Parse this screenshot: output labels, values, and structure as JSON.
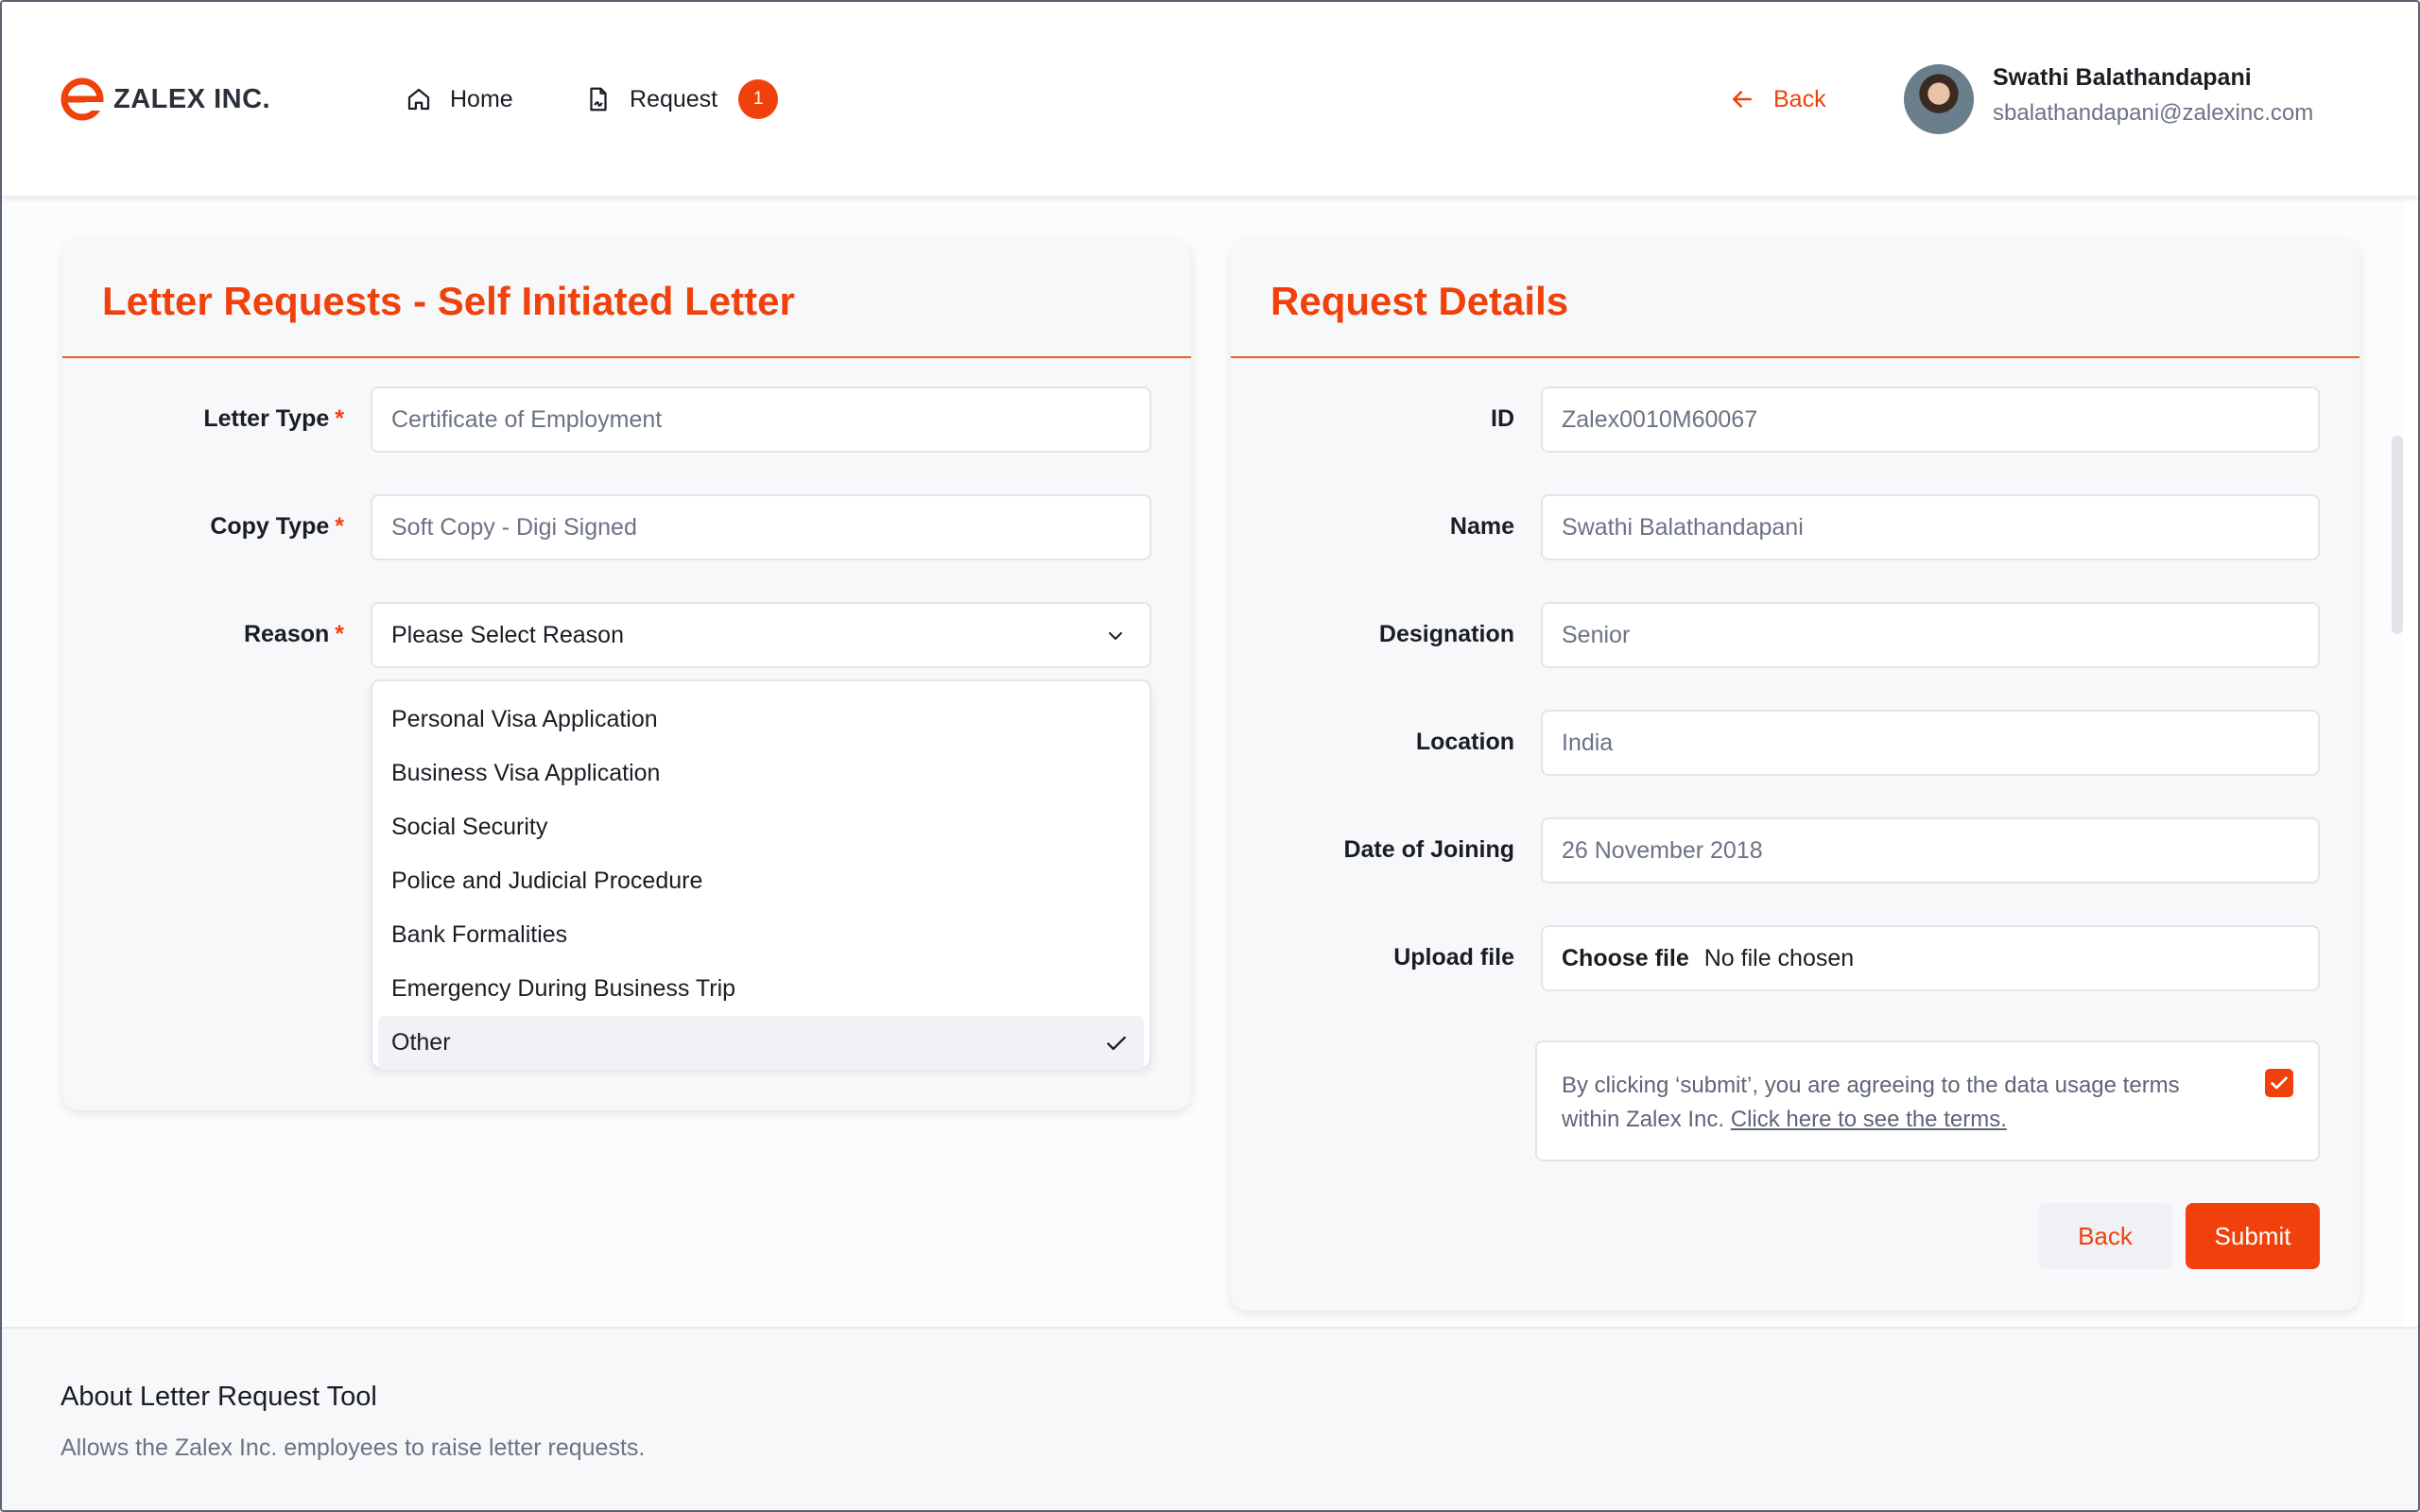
{
  "header": {
    "logo_text": "ZALEX INC.",
    "nav": [
      {
        "label": "Home",
        "icon": "home-icon"
      },
      {
        "label": "Request",
        "icon": "file-signature-icon",
        "badge": "1"
      }
    ],
    "back_label": "Back",
    "user": {
      "name": "Swathi Balathandapani",
      "email": "sbalathandapani@zalexinc.com"
    }
  },
  "letter_card": {
    "title": "Letter Requests - Self Initiated Letter",
    "fields": [
      {
        "label": "Letter Type",
        "required": "*",
        "placeholder": "Certificate of Employment"
      },
      {
        "label": "Copy Type",
        "required": "*",
        "placeholder": "Soft Copy - Digi Signed"
      },
      {
        "label": "Reason",
        "required": "*",
        "value": "Please Select Reason"
      }
    ],
    "reason_options": [
      "Personal Visa Application",
      "Business Visa Application",
      "Social Security",
      "Police and Judicial Procedure",
      "Bank Formalities",
      "Emergency During Business Trip",
      "Other"
    ],
    "selected_option": "Other"
  },
  "details_card": {
    "title": "Request Details",
    "fields": [
      {
        "label": "ID",
        "placeholder": "Zalex0010M60067"
      },
      {
        "label": "Name",
        "placeholder": "Swathi Balathandapani"
      },
      {
        "label": "Designation",
        "placeholder": "Senior"
      },
      {
        "label": "Location",
        "placeholder": "India"
      },
      {
        "label": "Date of Joining",
        "placeholder": "26 November 2018"
      }
    ],
    "upload": {
      "label": "Upload file",
      "button": "Choose file",
      "status": "No file chosen"
    },
    "terms": {
      "text": "By clicking ‘submit’, you are agreeing to the data usage terms within Zalex Inc.",
      "link": "Click here to see the terms.",
      "checked": true
    },
    "back_button": "Back",
    "submit_button": "Submit"
  },
  "footer": {
    "title": "About Letter Request Tool",
    "description": "Allows the Zalex Inc. employees to raise letter requests."
  },
  "colors": {
    "accent": "#f0410c",
    "card_bg": "#f7f8fa",
    "border": "#e3e5ea"
  }
}
